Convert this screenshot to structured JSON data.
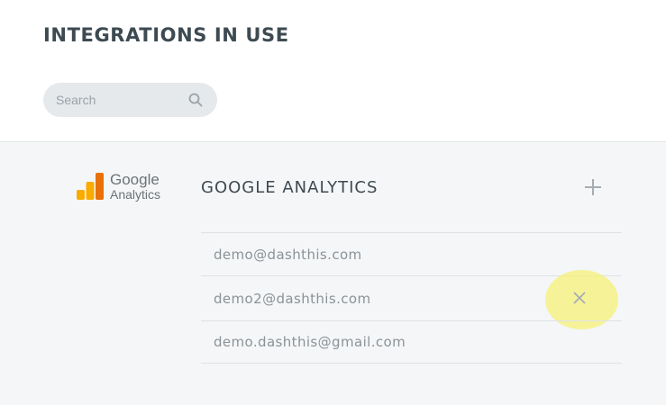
{
  "header": {
    "title": "INTEGRATIONS IN USE"
  },
  "search": {
    "placeholder": "Search",
    "value": "",
    "icon": "search-icon"
  },
  "integration": {
    "logo": {
      "line1": "Google",
      "line2": "Analytics",
      "icon": "google-analytics-logo-icon"
    },
    "name": "GOOGLE ANALYTICS",
    "add_icon": "plus-icon",
    "accounts": [
      {
        "email": "demo@dashthis.com"
      },
      {
        "email": "demo2@dashthis.com",
        "remove_icon": "close-icon",
        "hovered": true
      },
      {
        "email": "demo.dashthis@gmail.com"
      }
    ]
  },
  "colors": {
    "title": "#3d4a52",
    "panel_bg": "#f5f6f7",
    "search_bg": "#e6e9eb",
    "highlight": "#f5f078",
    "ga_orange_dark": "#e8710a",
    "ga_orange_light": "#f9ab00"
  }
}
